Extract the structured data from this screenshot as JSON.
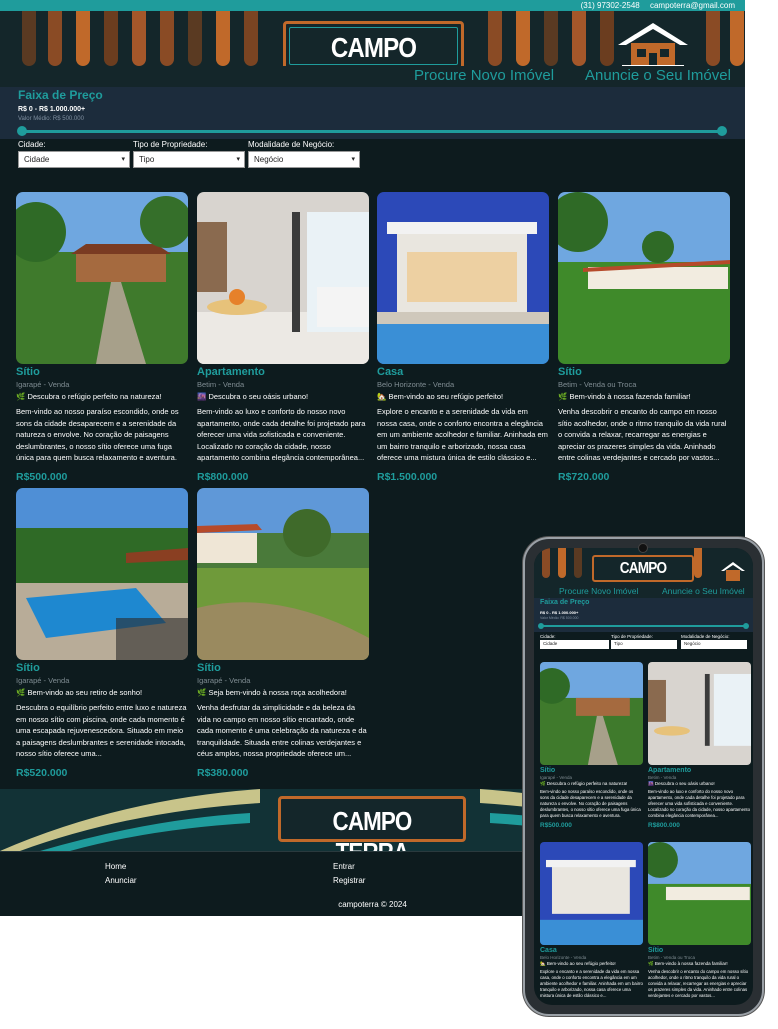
{
  "topbar": {
    "phone": "(31) 97302-2548",
    "email": "campoterra@gmail.com"
  },
  "brand": {
    "logo": "CAMPO TERRA",
    "colors": {
      "accent": "#1f9c9c",
      "background": "#0d1b1e",
      "logo_border": "#c0692a"
    }
  },
  "nav": {
    "search": "Procure Novo Imóvel",
    "advertise": "Anuncie o Seu Imóvel"
  },
  "filter": {
    "title": "Faixa de Preço",
    "range": "R$ 0 - R$ 1.000.000+",
    "average": "Valor Médio: R$ 500.000",
    "slider": {
      "min": 0,
      "max": 1000000
    },
    "city_label": "Cidade:",
    "city_value": "Cidade",
    "type_label": "Tipo de Propriedade:",
    "type_value": "Tipo",
    "deal_label": "Modalidade de Negócio:",
    "deal_value": "Negócio"
  },
  "listings": [
    {
      "title": "Sítio",
      "location": "Igarapé - Venda",
      "emoji": "🌿",
      "headline": "Descubra o refúgio perfeito na natureza!",
      "description": "Bem-vindo ao nosso paraíso escondido, onde os sons da cidade desaparecem e a serenidade da natureza o envolve. No coração de paisagens deslumbrantes, o nosso sítio oferece uma fuga única para quem busca relaxamento e aventura.",
      "price": "R$500.000"
    },
    {
      "title": "Apartamento",
      "location": "Betim - Venda",
      "emoji": "🌆",
      "headline": "Descubra o seu oásis urbano!",
      "description": "Bem-vindo ao luxo e conforto do nosso novo apartamento, onde cada detalhe foi projetado para oferecer uma vida sofisticada e conveniente. Localizado no coração da cidade, nosso apartamento combina elegância contemporânea...",
      "price": "R$800.000"
    },
    {
      "title": "Casa",
      "location": "Belo Horizonte - Venda",
      "emoji": "🏡",
      "headline": "Bem-vindo ao seu refúgio perfeito!",
      "description": "Explore o encanto e a serenidade da vida em nossa casa, onde o conforto encontra a elegância em um ambiente acolhedor e familiar. Aninhada em um bairro tranquilo e arborizado, nossa casa oferece uma mistura única de estilo clássico e...",
      "price": "R$1.500.000"
    },
    {
      "title": "Sítio",
      "location": "Betim - Venda ou Troca",
      "emoji": "🌿",
      "headline": "Bem-vindo à nossa fazenda familiar!",
      "description": "Venha descobrir o encanto do campo em nosso sítio acolhedor, onde o ritmo tranquilo da vida rural o convida a relaxar, recarregar as energias e apreciar os prazeres simples da vida. Aninhado entre colinas verdejantes e cercado por vastos...",
      "price": "R$720.000"
    },
    {
      "title": "Sítio",
      "location": "Igarapé - Venda",
      "emoji": "🌿",
      "headline": "Bem-vindo ao seu retiro de sonho!",
      "description": "Descubra o equilíbrio perfeito entre luxo e natureza em nosso sítio com piscina, onde cada momento é uma escapada rejuvenescedora. Situado em meio a paisagens deslumbrantes e serenidade intocada, nosso sítio oferece uma...",
      "price": "R$520.000"
    },
    {
      "title": "Sítio",
      "location": "Igarapé - Venda",
      "emoji": "🌿",
      "headline": "Seja bem-vindo à nossa roça acolhedora!",
      "description": "Venha desfrutar da simplicidade e da beleza da vida no campo em nosso sítio encantado, onde cada momento é uma celebração da natureza e da tranquilidade. Situada entre colinas verdejantes e céus amplos, nossa propriedade oferece um...",
      "price": "R$380.000"
    }
  ],
  "footer": {
    "home": "Home",
    "advertise": "Anunciar",
    "login": "Entrar",
    "register": "Registrar",
    "copyright": "campoterra © 2024"
  },
  "mobile": {
    "listings": [
      {
        "title": "Sítio",
        "location": "Igarapé - Venda",
        "emoji": "🌿",
        "headline": "Descubra o refúgio perfeito na natureza!",
        "description": "Bem-vindo ao nosso paraíso escondido, onde os sons da cidade desaparecem e a serenidade da natureza o envolve. No coração de paisagens deslumbrantes, o nosso sítio oferece uma fuga única para quem busca relaxamento e aventura.",
        "price": "R$500.000"
      },
      {
        "title": "Apartamento",
        "location": "Betim - Venda",
        "emoji": "🌆",
        "headline": "Descubra o seu oásis urbano!",
        "description": "Bem-vindo ao luxo e conforto do nosso novo apartamento, onde cada detalhe foi projetado para oferecer uma vida sofisticada e conveniente. Localizado no coração da cidade, nosso apartamento combina elegância contemporânea...",
        "price": "R$800.000"
      },
      {
        "title": "Casa",
        "location": "Belo Horizonte - Venda",
        "emoji": "🏡",
        "headline": "Bem-vindo ao seu refúgio perfeito!",
        "description": "Explore o encanto e a serenidade da vida em nossa casa, onde o conforto encontra a elegância em um ambiente acolhedor e familiar. Aninhada em um bairro tranquilo e arborizado, nossa casa oferece uma mistura única de estilo clássico e...",
        "price": ""
      },
      {
        "title": "Sítio",
        "location": "Betim - Venda ou Troca",
        "emoji": "🌿",
        "headline": "Bem-vindo à nossa fazenda familiar!",
        "description": "Venha descobrir o encanto do campo em nosso sítio acolhedor, onde o ritmo tranquilo da vida rural o convida a relaxar, recarregar as energias e apreciar os prazeres simples da vida. Aninhado entre colinas verdejantes e cercado por vastos...",
        "price": ""
      }
    ]
  }
}
